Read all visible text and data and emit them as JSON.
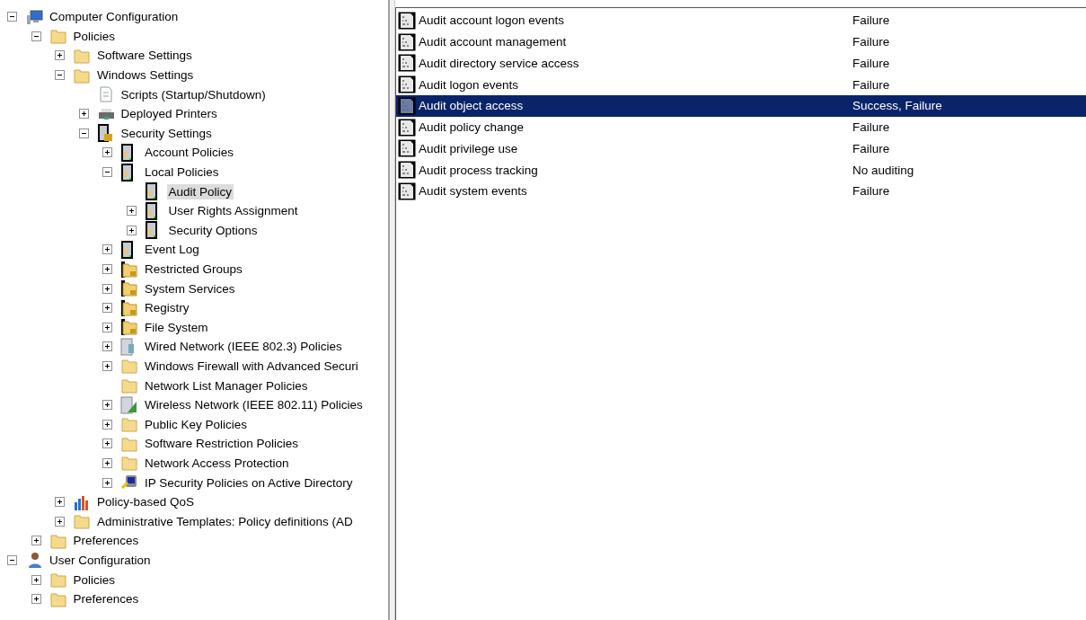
{
  "tree": [
    {
      "label": "Computer Configuration",
      "kind": "computer",
      "expanded": true,
      "selected": false,
      "children": [
        {
          "label": "Policies",
          "kind": "folder",
          "expanded": true,
          "selected": false,
          "children": [
            {
              "label": "Software Settings",
              "kind": "folder",
              "expanded": false,
              "selected": false
            },
            {
              "label": "Windows Settings",
              "kind": "folder",
              "expanded": true,
              "selected": false,
              "children": [
                {
                  "label": "Scripts (Startup/Shutdown)",
                  "kind": "script",
                  "selected": false
                },
                {
                  "label": "Deployed Printers",
                  "kind": "printer",
                  "expanded": false,
                  "selected": false
                },
                {
                  "label": "Security Settings",
                  "kind": "security",
                  "expanded": true,
                  "selected": false,
                  "children": [
                    {
                      "label": "Account Policies",
                      "kind": "policy",
                      "expanded": false,
                      "selected": false
                    },
                    {
                      "label": "Local Policies",
                      "kind": "policy",
                      "expanded": true,
                      "selected": false,
                      "children": [
                        {
                          "label": "Audit Policy",
                          "kind": "policy",
                          "selected": true
                        },
                        {
                          "label": "User Rights Assignment",
                          "kind": "policy",
                          "expanded": false,
                          "selected": false
                        },
                        {
                          "label": "Security Options",
                          "kind": "policy",
                          "expanded": false,
                          "selected": false
                        }
                      ]
                    },
                    {
                      "label": "Event Log",
                      "kind": "policy",
                      "expanded": false,
                      "selected": false
                    },
                    {
                      "label": "Restricted Groups",
                      "kind": "lockfolder",
                      "expanded": false,
                      "selected": false
                    },
                    {
                      "label": "System Services",
                      "kind": "lockfolder",
                      "expanded": false,
                      "selected": false
                    },
                    {
                      "label": "Registry",
                      "kind": "lockfolder",
                      "expanded": false,
                      "selected": false
                    },
                    {
                      "label": "File System",
                      "kind": "lockfolder",
                      "expanded": false,
                      "selected": false
                    },
                    {
                      "label": "Wired Network (IEEE 802.3) Policies",
                      "kind": "network",
                      "expanded": false,
                      "selected": false
                    },
                    {
                      "label": "Windows Firewall with Advanced Securi",
                      "kind": "folder",
                      "expanded": false,
                      "selected": false
                    },
                    {
                      "label": "Network List Manager Policies",
                      "kind": "folder",
                      "selected": false
                    },
                    {
                      "label": "Wireless Network (IEEE 802.11) Policies",
                      "kind": "wireless",
                      "expanded": false,
                      "selected": false
                    },
                    {
                      "label": "Public Key Policies",
                      "kind": "folder",
                      "expanded": false,
                      "selected": false
                    },
                    {
                      "label": "Software Restriction Policies",
                      "kind": "folder",
                      "expanded": false,
                      "selected": false
                    },
                    {
                      "label": "Network Access Protection",
                      "kind": "folder",
                      "expanded": false,
                      "selected": false
                    },
                    {
                      "label": "IP Security Policies on Active Directory",
                      "kind": "ipsec",
                      "expanded": false,
                      "selected": false
                    }
                  ]
                }
              ]
            },
            {
              "label": "Policy-based QoS",
              "kind": "qos",
              "expanded": false,
              "selected": false
            },
            {
              "label": "Administrative Templates: Policy definitions (AD",
              "kind": "folder",
              "expanded": false,
              "selected": false
            }
          ]
        },
        {
          "label": "Preferences",
          "kind": "folder",
          "expanded": false,
          "selected": false
        }
      ]
    },
    {
      "label": "User Configuration",
      "kind": "user",
      "expanded": true,
      "selected": false,
      "children": [
        {
          "label": "Policies",
          "kind": "folder",
          "expanded": false,
          "selected": false
        },
        {
          "label": "Preferences",
          "kind": "folder",
          "expanded": false,
          "selected": false
        }
      ]
    }
  ],
  "policies": [
    {
      "name": "Audit account logon events",
      "setting": "Failure",
      "selected": false
    },
    {
      "name": "Audit account management",
      "setting": "Failure",
      "selected": false
    },
    {
      "name": "Audit directory service access",
      "setting": "Failure",
      "selected": false
    },
    {
      "name": "Audit logon events",
      "setting": "Failure",
      "selected": false
    },
    {
      "name": "Audit object access",
      "setting": "Success, Failure",
      "selected": true
    },
    {
      "name": "Audit policy change",
      "setting": "Failure",
      "selected": false
    },
    {
      "name": "Audit privilege use",
      "setting": "Failure",
      "selected": false
    },
    {
      "name": "Audit process tracking",
      "setting": "No auditing",
      "selected": false
    },
    {
      "name": "Audit system events",
      "setting": "Failure",
      "selected": false
    }
  ]
}
